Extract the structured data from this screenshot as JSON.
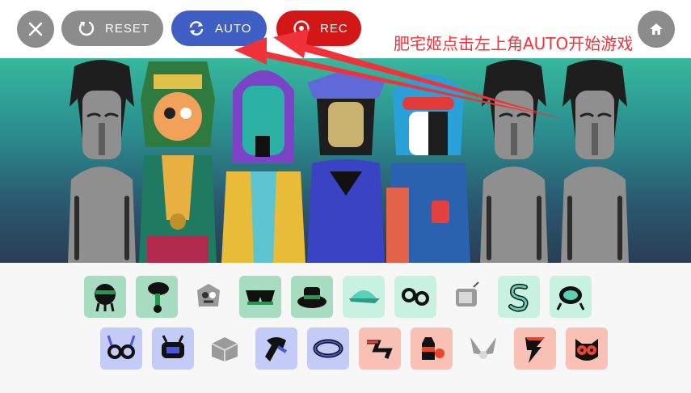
{
  "toolbar": {
    "close_icon": "close-icon",
    "reset_label": "RESET",
    "auto_label": "AUTO",
    "rec_label": "REC",
    "home_icon": "home-icon"
  },
  "annotation": {
    "text": "肥宅姬点击左上角AUTO开始游戏"
  },
  "colors": {
    "reset": "#8c8c8c",
    "auto": "#3f5fc4",
    "rec": "#d31616",
    "annotation": "#f0333a",
    "beat": "#a8dcc0",
    "effect": "#c9f1e2",
    "melody": "#c5cbf7",
    "voice": "#f9c1b6"
  },
  "stage": {
    "characters": [
      {
        "kind": "gray"
      },
      {
        "kind": "green-hood"
      },
      {
        "kind": "purple-hood"
      },
      {
        "kind": "blue-hat"
      },
      {
        "kind": "red-mask"
      },
      {
        "kind": "gray"
      },
      {
        "kind": "gray"
      }
    ]
  },
  "palette": {
    "row1": [
      {
        "icon": "beat-ball-icon",
        "group": "beat"
      },
      {
        "icon": "beat-stick-icon",
        "group": "beat"
      },
      {
        "icon": "mask-icon",
        "group": "neutral"
      },
      {
        "icon": "glasses-icon",
        "group": "beat"
      },
      {
        "icon": "hat-icon",
        "group": "beat"
      },
      {
        "icon": "cap-icon",
        "group": "effect"
      },
      {
        "icon": "loop-icon",
        "group": "effect"
      },
      {
        "icon": "tv-icon",
        "group": "neutral"
      },
      {
        "icon": "swirl-icon",
        "group": "effect"
      },
      {
        "icon": "turtle-icon",
        "group": "effect"
      }
    ],
    "row2": [
      {
        "icon": "antenna-glasses-icon",
        "group": "melody"
      },
      {
        "icon": "robot-icon",
        "group": "melody"
      },
      {
        "icon": "box-icon",
        "group": "neutral"
      },
      {
        "icon": "scarf-icon",
        "group": "melody"
      },
      {
        "icon": "ring-icon",
        "group": "melody"
      },
      {
        "icon": "zigzag-icon",
        "group": "voice"
      },
      {
        "icon": "bottle-icon",
        "group": "voice"
      },
      {
        "icon": "wings-icon",
        "group": "neutral"
      },
      {
        "icon": "bolt-icon",
        "group": "voice"
      },
      {
        "icon": "owl-icon",
        "group": "voice"
      }
    ]
  }
}
